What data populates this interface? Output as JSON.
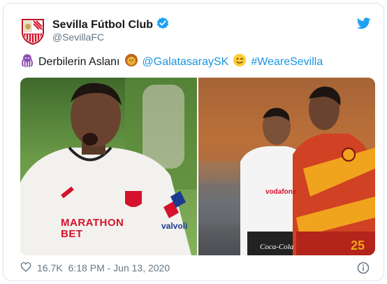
{
  "account": {
    "display_name": "Sevilla Fútbol Club",
    "handle": "@SevillaFC",
    "verified": true
  },
  "tweet": {
    "text_part1": "Derbilerin Aslanı",
    "mention": "@GalatasaraySK",
    "hashtag": "#WeareSevilla",
    "emojis": [
      "octopus",
      "lion-face",
      "winking-face"
    ]
  },
  "media": {
    "left_photo": {
      "shirt_sponsor": "MARATHON BET",
      "sleeve_sponsor": "valvoli"
    },
    "right_photo": {
      "shirt_number": "25",
      "shirt_text": "vodafone",
      "shorts_sponsor": "Coca-Cola"
    }
  },
  "footer": {
    "likes": "16.7K",
    "time": "6:18 PM - Jun 13, 2020"
  },
  "colors": {
    "link": "#1b95e0",
    "text": "#14171a",
    "secondary": "#657786",
    "twitter_blue": "#1da1f2",
    "sevilla_red": "#d5122b"
  }
}
